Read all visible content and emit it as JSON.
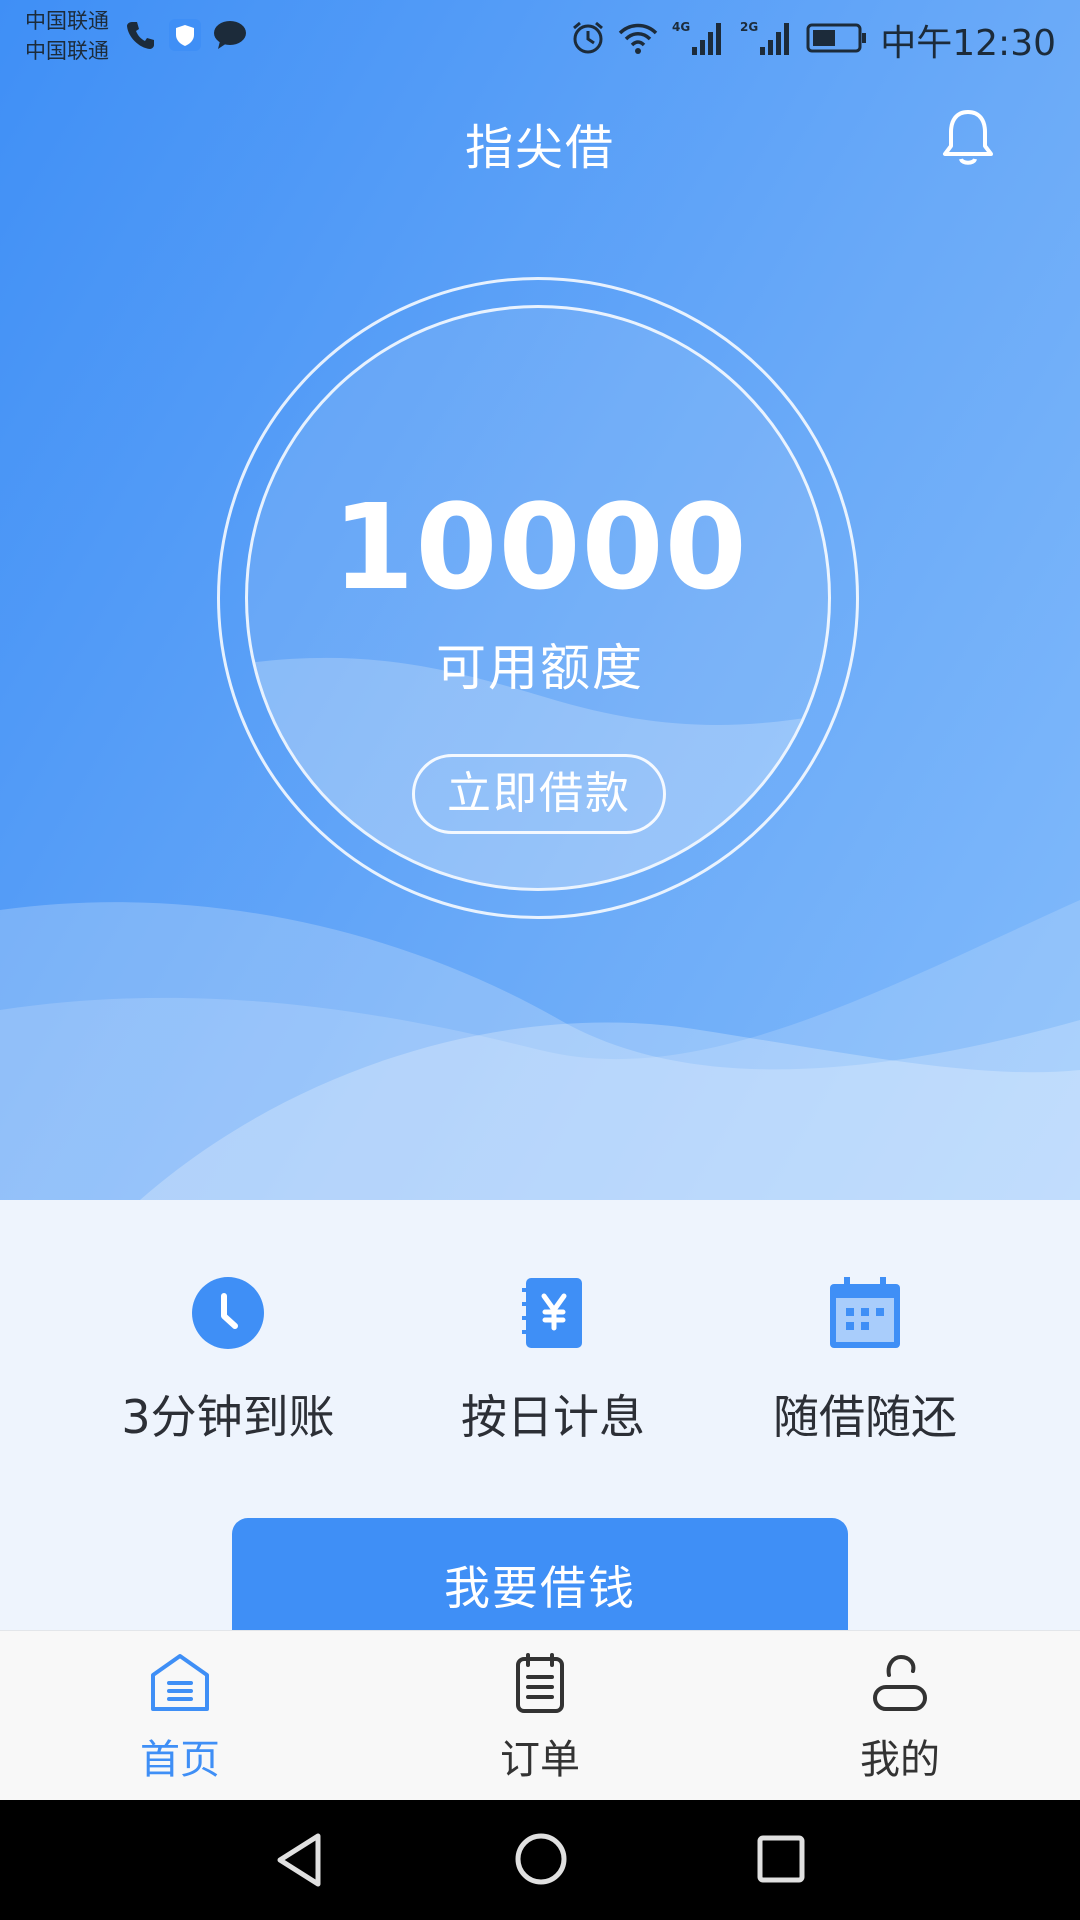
{
  "status_bar": {
    "carrier_1": "中国联通",
    "carrier_2": "中国联通",
    "time": "中午12:30",
    "network_1": "4G",
    "network_2": "2G"
  },
  "header": {
    "title": "指尖借",
    "bell_icon": "bell-icon"
  },
  "credit": {
    "amount": "10000",
    "label": "可用额度",
    "borrow_button": "立即借款"
  },
  "features": [
    {
      "label": "3分钟到账",
      "icon": "clock-icon"
    },
    {
      "label": "按日计息",
      "icon": "yuan-notebook-icon"
    },
    {
      "label": "随借随还",
      "icon": "calendar-icon"
    }
  ],
  "cta": {
    "label": "我要借钱"
  },
  "tabs": [
    {
      "label": "首页",
      "icon": "home-icon",
      "active": true
    },
    {
      "label": "订单",
      "icon": "order-list-icon",
      "active": false
    },
    {
      "label": "我的",
      "icon": "profile-icon",
      "active": false
    }
  ],
  "colors": {
    "accent": "#3f8ff6",
    "tab_active": "#3f8ff6",
    "tab_inactive": "#333333"
  }
}
